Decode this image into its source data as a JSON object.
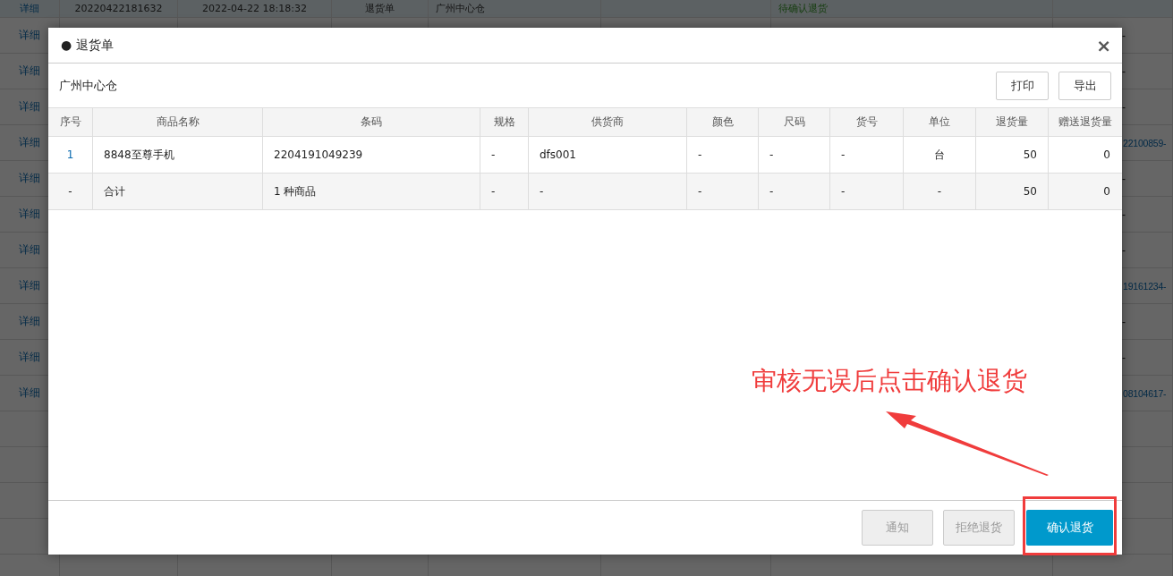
{
  "background_table": {
    "rows": [
      {
        "cells": [
          "详细",
          "20220422181632",
          "2022-04-22 18:18:32",
          "退货单",
          "广州中心仓",
          "",
          "待确认退货",
          ""
        ]
      },
      {
        "cells": [
          "详细",
          "",
          "",
          "",
          "",
          "",
          "",
          "-"
        ]
      },
      {
        "cells": [
          "详细",
          "",
          "",
          "",
          "",
          "",
          "",
          "-"
        ]
      },
      {
        "cells": [
          "详细",
          "",
          "",
          "",
          "",
          "",
          "",
          "-"
        ]
      },
      {
        "cells": [
          "详细",
          "",
          "",
          "",
          "",
          "",
          "",
          "22100859-"
        ]
      },
      {
        "cells": [
          "详细",
          "",
          "",
          "",
          "",
          "",
          "",
          "-"
        ]
      },
      {
        "cells": [
          "详细",
          "",
          "",
          "",
          "",
          "",
          "",
          "-"
        ]
      },
      {
        "cells": [
          "详细",
          "",
          "",
          "",
          "",
          "",
          "",
          "-"
        ]
      },
      {
        "cells": [
          "详细",
          "",
          "",
          "",
          "",
          "",
          "",
          "19161234-"
        ]
      },
      {
        "cells": [
          "详细",
          "",
          "",
          "",
          "",
          "",
          "",
          "-"
        ]
      },
      {
        "cells": [
          "详细",
          "",
          "",
          "",
          "",
          "",
          "",
          "-"
        ]
      },
      {
        "cells": [
          "详细",
          "",
          "",
          "",
          "",
          "",
          "",
          "08104617-"
        ]
      }
    ]
  },
  "dialog": {
    "title": "● 退货单",
    "close": "×",
    "warehouse": "广州中心仓",
    "toolbar_buttons": [
      "打印",
      "导出"
    ],
    "table": {
      "columns": [
        "序号",
        "商品名称",
        "条码",
        "规格",
        "供货商",
        "颜色",
        "尺码",
        "货号",
        "单位",
        "退货量",
        "赠送退货量"
      ],
      "rows": [
        {
          "kind": "item",
          "cells": [
            "1",
            "8848至尊手机",
            "2204191049239",
            "-",
            "dfs001",
            "-",
            "-",
            "-",
            "台",
            "50",
            "0"
          ]
        },
        {
          "kind": "total",
          "cells": [
            "-",
            "合计",
            "1 种商品",
            "-",
            "-",
            "-",
            "-",
            "-",
            "-",
            "50",
            "0"
          ]
        }
      ]
    },
    "footer_buttons": [
      {
        "label": "通知",
        "kind": "default",
        "disabled": true
      },
      {
        "label": "拒绝退货",
        "kind": "default",
        "disabled": true
      },
      {
        "label": "确认退货",
        "kind": "primary",
        "disabled": false
      }
    ]
  },
  "annotation": {
    "text": "审核无误后点击确认退货"
  }
}
